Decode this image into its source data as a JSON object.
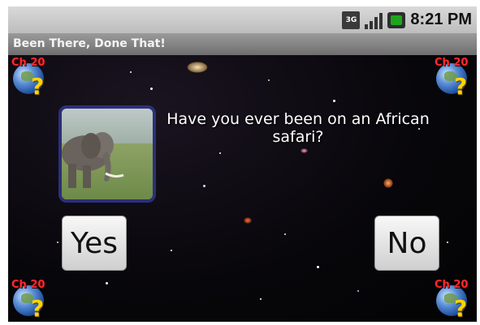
{
  "status_bar": {
    "network": "3G",
    "time": "8:21 PM",
    "signal_icon": "signal-bars-icon",
    "battery_icon": "battery-icon"
  },
  "app": {
    "title": "Been There, Done That!"
  },
  "badges": {
    "label": "Ch 20",
    "icon": "globe-question-icon"
  },
  "question": {
    "text": "Have you ever been on an African safari?",
    "image": "elephant-photo"
  },
  "buttons": {
    "yes_label": "Yes",
    "no_label": "No"
  },
  "colors": {
    "status_bar": "#c8c8c8",
    "title_bar": "#808080",
    "photo_border": "#2c2f7a",
    "badge_label": "#ff2a2a",
    "question_mark": "#ffd400"
  }
}
